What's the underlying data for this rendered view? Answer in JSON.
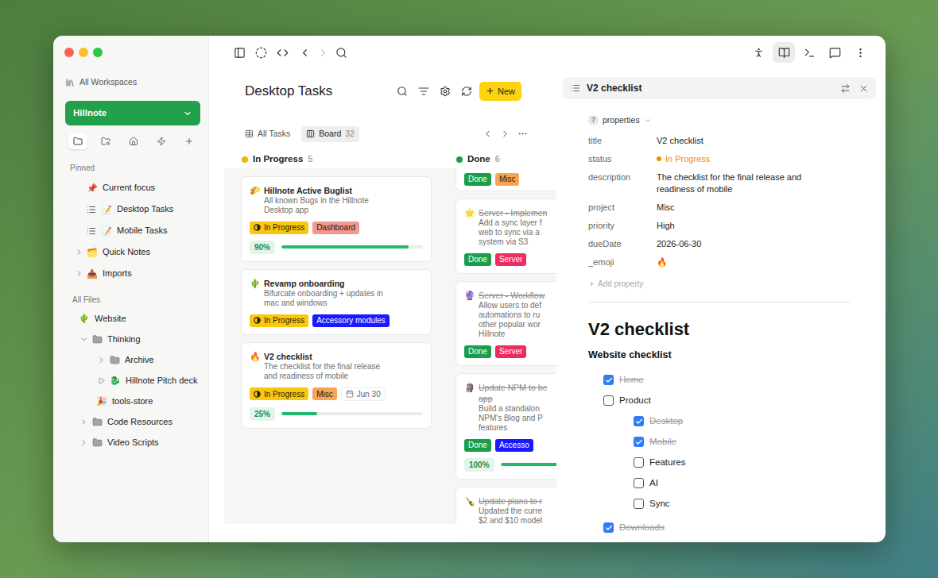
{
  "sidebar": {
    "workspaces_link": "All Workspaces",
    "workspace": "Hillnote",
    "tool_tabs": [
      {
        "selected": true
      },
      {
        "selected": false
      },
      {
        "selected": false
      },
      {
        "selected": false
      },
      {
        "selected": false
      }
    ],
    "pinned_label": "Pinned",
    "pinned": [
      {
        "label": "Current focus",
        "emoji": "📌",
        "kind": "page"
      },
      {
        "label": "Desktop Tasks",
        "emoji": "📝",
        "kind": "list"
      },
      {
        "label": "Mobile Tasks",
        "emoji": "📝",
        "kind": "list"
      },
      {
        "label": "Quick Notes",
        "emoji": "🗂️",
        "kind": "folder",
        "expanded": false
      },
      {
        "label": "Imports",
        "emoji": "📥",
        "kind": "folder",
        "expanded": false
      }
    ],
    "files_label": "All Files",
    "files": [
      {
        "label": "Website",
        "emoji": "🌵",
        "kind": "page"
      },
      {
        "label": "Thinking",
        "kind": "folder",
        "expanded": true,
        "children": [
          {
            "label": "Archive",
            "kind": "folder",
            "expanded": false
          },
          {
            "label": "Hillnote Pitch deck",
            "emoji": "🐉",
            "kind": "deck",
            "expanded": false
          },
          {
            "label": "tools-store",
            "emoji": "🎉",
            "kind": "page"
          }
        ]
      },
      {
        "label": "Code Resources",
        "kind": "folder",
        "expanded": false
      },
      {
        "label": "Video Scripts",
        "kind": "folder",
        "expanded": false
      }
    ]
  },
  "toolbar": {
    "history": [
      {
        "disabled": false
      },
      {
        "disabled": true
      }
    ],
    "panels": [
      {
        "selected": false
      },
      {
        "selected": true
      },
      {
        "selected": false
      },
      {
        "selected": false
      },
      {
        "selected": false
      }
    ]
  },
  "board": {
    "title": "Desktop Tasks",
    "new_button": "New",
    "views": [
      {
        "label": "All Tasks",
        "selected": false
      },
      {
        "label": "Board",
        "count": "32",
        "selected": true
      }
    ],
    "columns": [
      {
        "name": "In Progress",
        "count": "5",
        "color": "#f5b400",
        "cards": [
          {
            "emoji": "🌮",
            "title_lines": [
              "Hillnote Active Buglist"
            ],
            "description_lines": [
              "All known Bugs in the Hillnote",
              "Desktop app"
            ],
            "tags": [
              {
                "label": "In Progress",
                "color": "#f9c80e",
                "kind": "status"
              },
              {
                "label": "Dashboard",
                "color": "#f4978e",
                "kind": "plain"
              }
            ],
            "progress": {
              "label": "90%",
              "level": 0.9
            }
          },
          {
            "emoji": "🌵",
            "title_lines": [
              "Revamp onboarding"
            ],
            "description_lines": [
              "Bifurcate onboarding + updates in",
              "mac and windows"
            ],
            "tags": [
              {
                "label": "In Progress",
                "color": "#f9c80e",
                "kind": "status"
              },
              {
                "label": "Accessory modules",
                "color": "#1a1aff",
                "kind": "plain"
              }
            ]
          },
          {
            "emoji": "🔥",
            "title_lines": [
              "V2 checklist"
            ],
            "description_lines": [
              "The checklist for the final release",
              "and readiness of mobile"
            ],
            "tags": [
              {
                "label": "In Progress",
                "color": "#f9c80e",
                "kind": "status"
              },
              {
                "label": "Misc",
                "color": "#f5a556",
                "kind": "plain"
              }
            ],
            "date": "Jun 30",
            "progress": {
              "label": "25%",
              "level": 0.25
            }
          }
        ]
      },
      {
        "name": "Done",
        "count": "6",
        "color": "#1b9e49",
        "cards": [
          {
            "title_lines": [],
            "description_lines": [],
            "tags": [
              {
                "label": "Done",
                "color": "#1b9e49",
                "kind": "plain"
              },
              {
                "label": "Misc",
                "color": "#f5a556",
                "kind": "plain"
              }
            ]
          },
          {
            "emoji": "🌟",
            "title_lines": [
              "Server - Implemen"
            ],
            "description_lines": [
              "Add a sync layer f",
              "web to sync via a",
              "system via S3"
            ],
            "tags": [
              {
                "label": "Done",
                "color": "#1b9e49",
                "kind": "plain"
              },
              {
                "label": "Server",
                "color": "#ef2b62",
                "kind": "plain"
              }
            ]
          },
          {
            "emoji": "🔮",
            "title_lines": [
              "Server - Workflow"
            ],
            "description_lines": [
              "Allow users to def",
              "automations to ru",
              "other popular wor",
              "Hillnote"
            ],
            "tags": [
              {
                "label": "Done",
                "color": "#1b9e49",
                "kind": "plain"
              },
              {
                "label": "Server",
                "color": "#ef2b62",
                "kind": "plain"
              }
            ]
          },
          {
            "emoji": "🗿",
            "title_lines": [
              "Update NPM to be",
              "app"
            ],
            "description_lines": [
              "Build a standalon",
              "NPM's Blog and P",
              "features"
            ],
            "tags": [
              {
                "label": "Done",
                "color": "#1b9e49",
                "kind": "plain"
              },
              {
                "label": "Accesso",
                "color": "#1a1aff",
                "kind": "plain"
              }
            ],
            "progress": {
              "label": "100%",
              "level": 1
            }
          },
          {
            "emoji": "🍾",
            "title_lines": [
              "Update plans to r"
            ],
            "description_lines": [
              "Updated the curre",
              "$2 and $10 model"
            ],
            "tags": []
          }
        ]
      }
    ]
  },
  "detail": {
    "title": "V2 checklist",
    "properties_count": "7",
    "properties_label": "properties",
    "properties": [
      {
        "key": "title",
        "value": "V2 checklist",
        "kind": "text"
      },
      {
        "key": "status",
        "value": "In Progress",
        "kind": "status",
        "color": "#f08c00"
      },
      {
        "key": "description",
        "value": "The checklist for the final release and readiness of mobile",
        "kind": "text"
      },
      {
        "key": "project",
        "value": "Misc",
        "kind": "text"
      },
      {
        "key": "priority",
        "value": "High",
        "kind": "text"
      },
      {
        "key": "dueDate",
        "value": "2026-06-30",
        "kind": "text"
      },
      {
        "key": "_emoji",
        "value": "🔥",
        "kind": "text"
      }
    ],
    "add_property": "Add property",
    "heading": "V2 checklist",
    "subheading": "Website checklist",
    "checklist": [
      {
        "label": "Home",
        "checked": true
      },
      {
        "label": "Product",
        "checked": false,
        "children": [
          {
            "label": "Desktop",
            "checked": true
          },
          {
            "label": "Mobile",
            "checked": true
          },
          {
            "label": "Features",
            "checked": false
          },
          {
            "label": "AI",
            "checked": false
          },
          {
            "label": "Sync",
            "checked": false
          }
        ]
      },
      {
        "label": "Downloads",
        "checked": true
      }
    ]
  }
}
